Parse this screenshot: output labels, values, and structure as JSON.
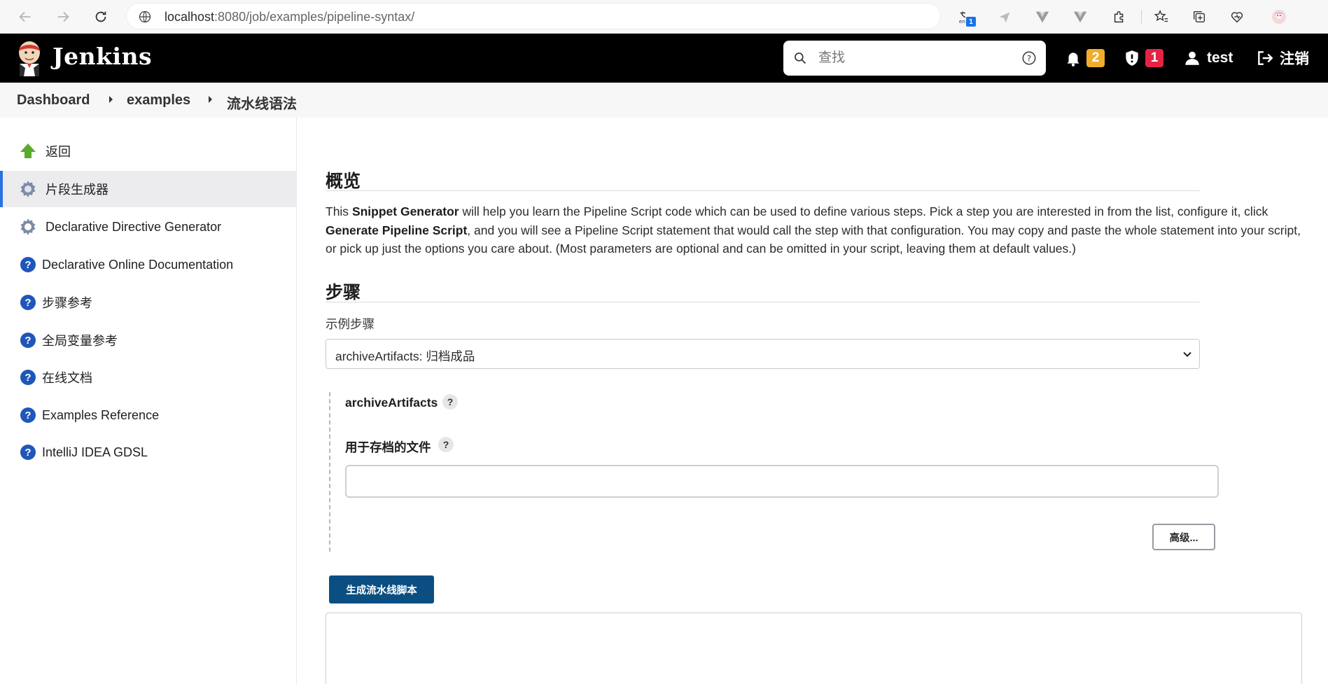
{
  "browser": {
    "url_host": "localhost",
    "url_path": ":8080/job/examples/pipeline-syntax/",
    "ext_badge_count": "1",
    "ext_badge_text": "en"
  },
  "header": {
    "brand": "Jenkins",
    "search_placeholder": "查找",
    "notifications_count": "2",
    "security_count": "1",
    "user": "test",
    "logout": "注销"
  },
  "breadcrumb": [
    "Dashboard",
    "examples",
    "流水线语法"
  ],
  "sidebar": {
    "items": [
      {
        "label": "返回",
        "icon": "up-arrow-icon"
      },
      {
        "label": "片段生成器",
        "icon": "gear-icon"
      },
      {
        "label": "Declarative Directive Generator",
        "icon": "gear-icon"
      },
      {
        "label": "Declarative Online Documentation",
        "icon": "help-icon"
      },
      {
        "label": "步骤参考",
        "icon": "help-icon"
      },
      {
        "label": "全局变量参考",
        "icon": "help-icon"
      },
      {
        "label": "在线文档",
        "icon": "help-icon"
      },
      {
        "label": "Examples Reference",
        "icon": "help-icon"
      },
      {
        "label": "IntelliJ IDEA GDSL",
        "icon": "help-icon"
      }
    ]
  },
  "main": {
    "overview_heading": "概览",
    "overview_p1": "This ",
    "overview_b1": "Snippet Generator",
    "overview_p2": " will help you learn the Pipeline Script code which can be used to define various steps. Pick a step you are interested in from the list, configure it, click ",
    "overview_b2": "Generate Pipeline Script",
    "overview_p3": ", and you will see a Pipeline Script statement that would call the step with that configuration. You may copy and paste the whole statement into your script, or pick up just the options you care about. (Most parameters are optional and can be omitted in your script, leaving them at default values.)",
    "steps_heading": "步骤",
    "sample_step_label": "示例步骤",
    "sample_step_value": "archiveArtifacts: 归档成品",
    "step_name": "archiveArtifacts",
    "files_label": "用于存档的文件",
    "files_value": "",
    "advanced_button": "高级...",
    "generate_button": "生成流水线脚本",
    "help_glyph": "?"
  },
  "colors": {
    "header_bg": "#000000",
    "primary_button": "#0b4f82",
    "notification_badge": "#f0ad2c",
    "security_badge": "#e42345",
    "active_accent": "#2a72e2"
  }
}
